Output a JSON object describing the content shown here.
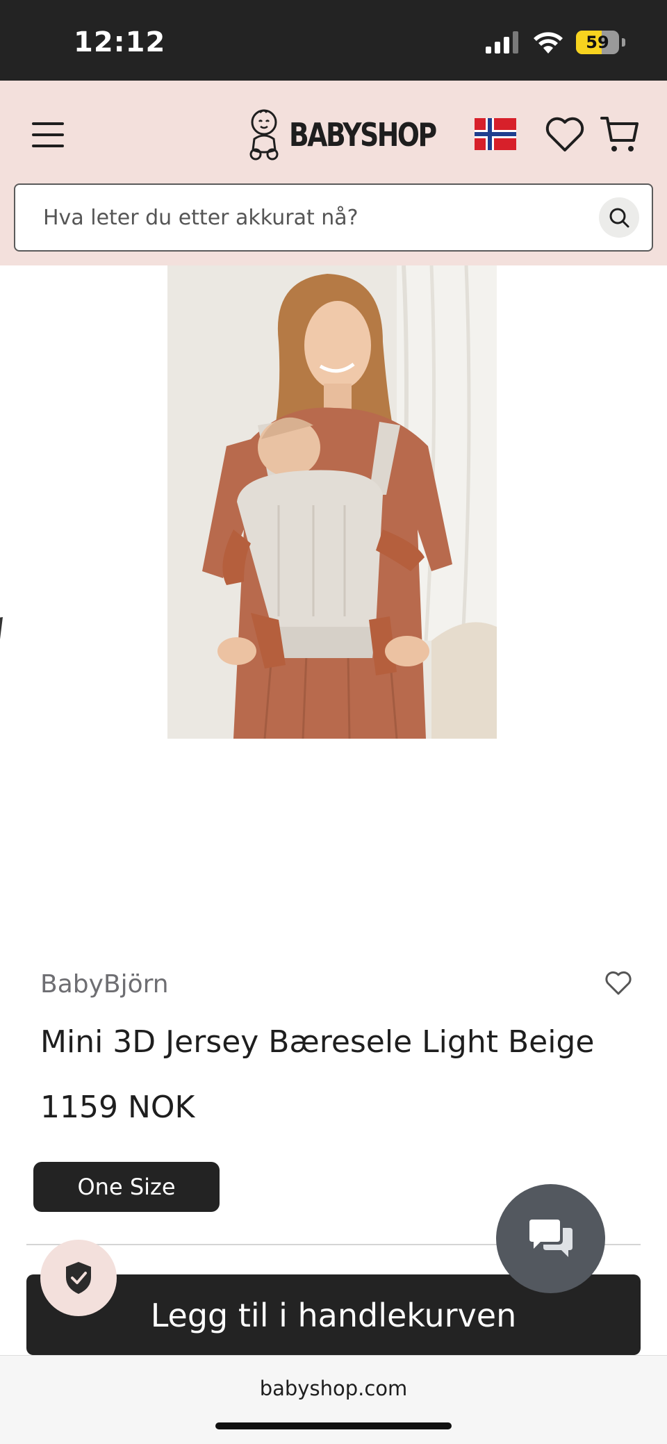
{
  "status_bar": {
    "time": "12:12",
    "battery": "59",
    "battery_level": 0.59,
    "icons": [
      "cellular-signal-icon",
      "wifi-icon",
      "battery-icon"
    ]
  },
  "header": {
    "logo_text": "BABYSHOP",
    "icons": [
      "menu-icon",
      "baby-logo-icon",
      "norway-flag-icon",
      "heart-icon",
      "cart-icon"
    ],
    "search": {
      "placeholder": "Hva leter du etter akkurat nå?"
    }
  },
  "product": {
    "brand": "BabyBjörn",
    "title": "Mini 3D Jersey Bæresele Light Beige",
    "price": "1159 NOK",
    "size_option": "One Size",
    "add_to_cart_label": "Legg til i handlekurven"
  },
  "floating": {
    "icons": [
      "chat-icon",
      "shield-check-icon"
    ]
  },
  "browser": {
    "url": "babyshop.com"
  },
  "colors": {
    "header_bg": "#f3e0dc",
    "button_dark": "#232323",
    "chat_bg": "#53585f",
    "brand_gray": "#6e6e72"
  }
}
